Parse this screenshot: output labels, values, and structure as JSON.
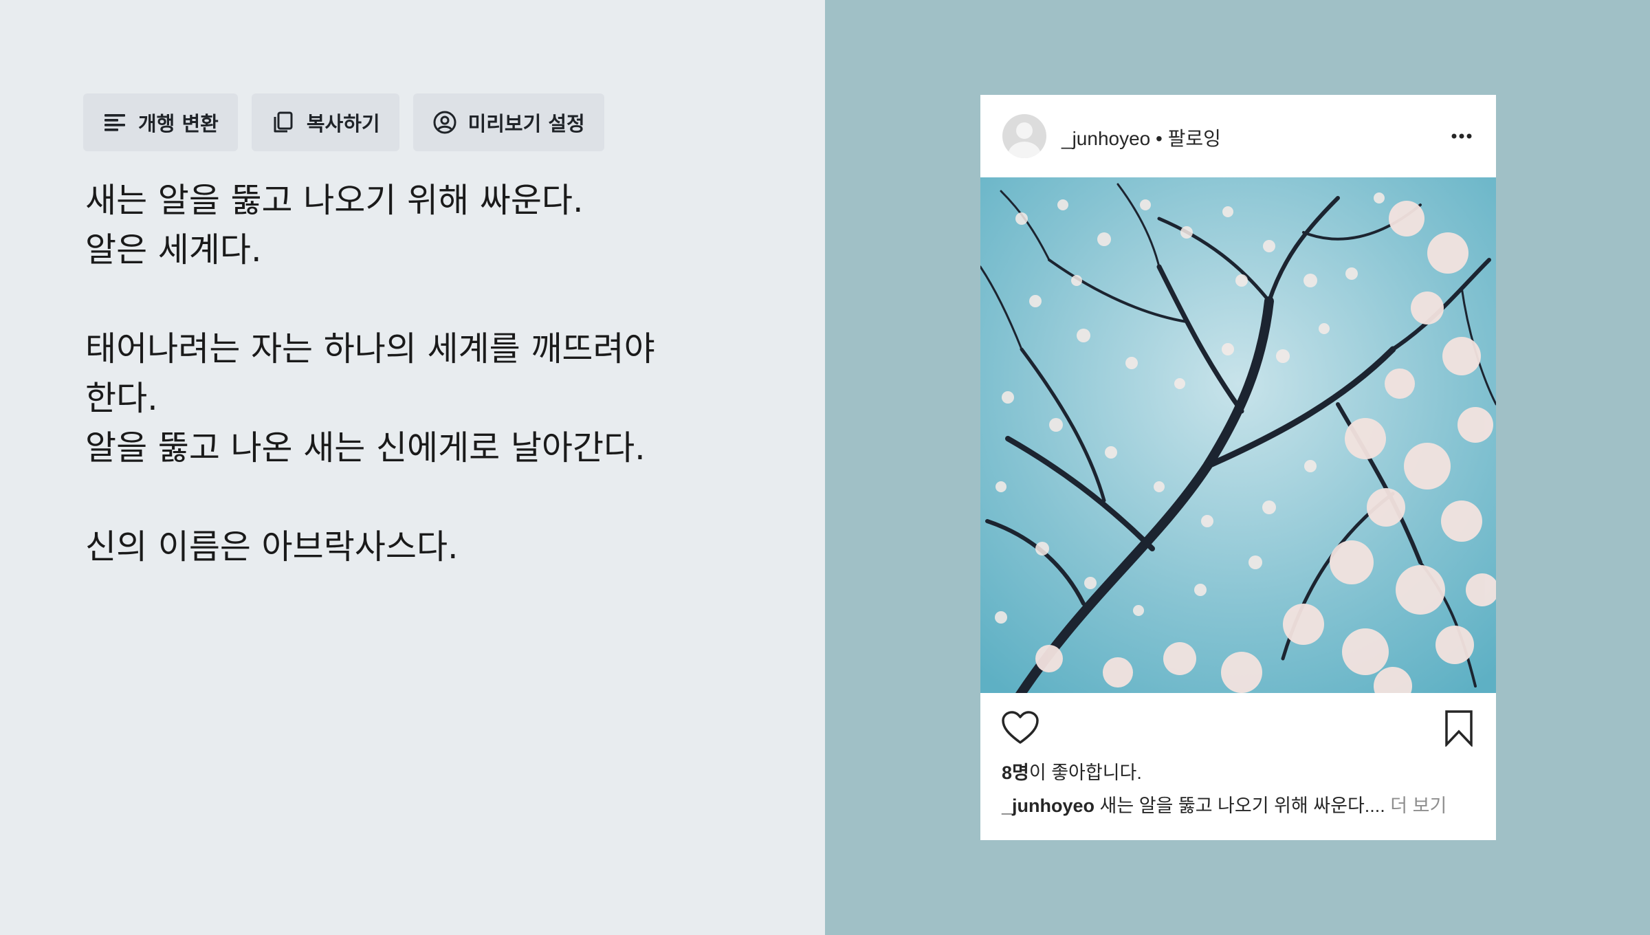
{
  "toolbar": {
    "wrap_label": "개행 변환",
    "copy_label": "복사하기",
    "preview_label": "미리보기 설정"
  },
  "editor": {
    "lines": [
      "새는 알을 뚫고 나오기 위해 싸운다.",
      "알은 세계다.",
      "",
      "태어나려는 자는 하나의 세계를 깨뜨려야",
      "한다.",
      "알을 뚫고 나온 새는 신에게로 날아간다.",
      "",
      "신의 이름은 아브락사스다."
    ]
  },
  "post": {
    "username": "_junhoyeo",
    "follow_text": "• 팔로잉",
    "likes_count": "8명",
    "likes_suffix": "이 좋아합니다.",
    "caption_user": "_junhoyeo",
    "caption_text": " 새는 알을 뚫고 나오기 위해 싸운다....",
    "more_text": " 더 보기",
    "image_desc_icon": "blossom-tree-photo"
  },
  "colors": {
    "left_bg": "#e8ecef",
    "right_bg": "#a0c0c6",
    "button_bg": "#dde1e6",
    "text": "#1a1a1a",
    "muted": "#8e8e8e"
  }
}
